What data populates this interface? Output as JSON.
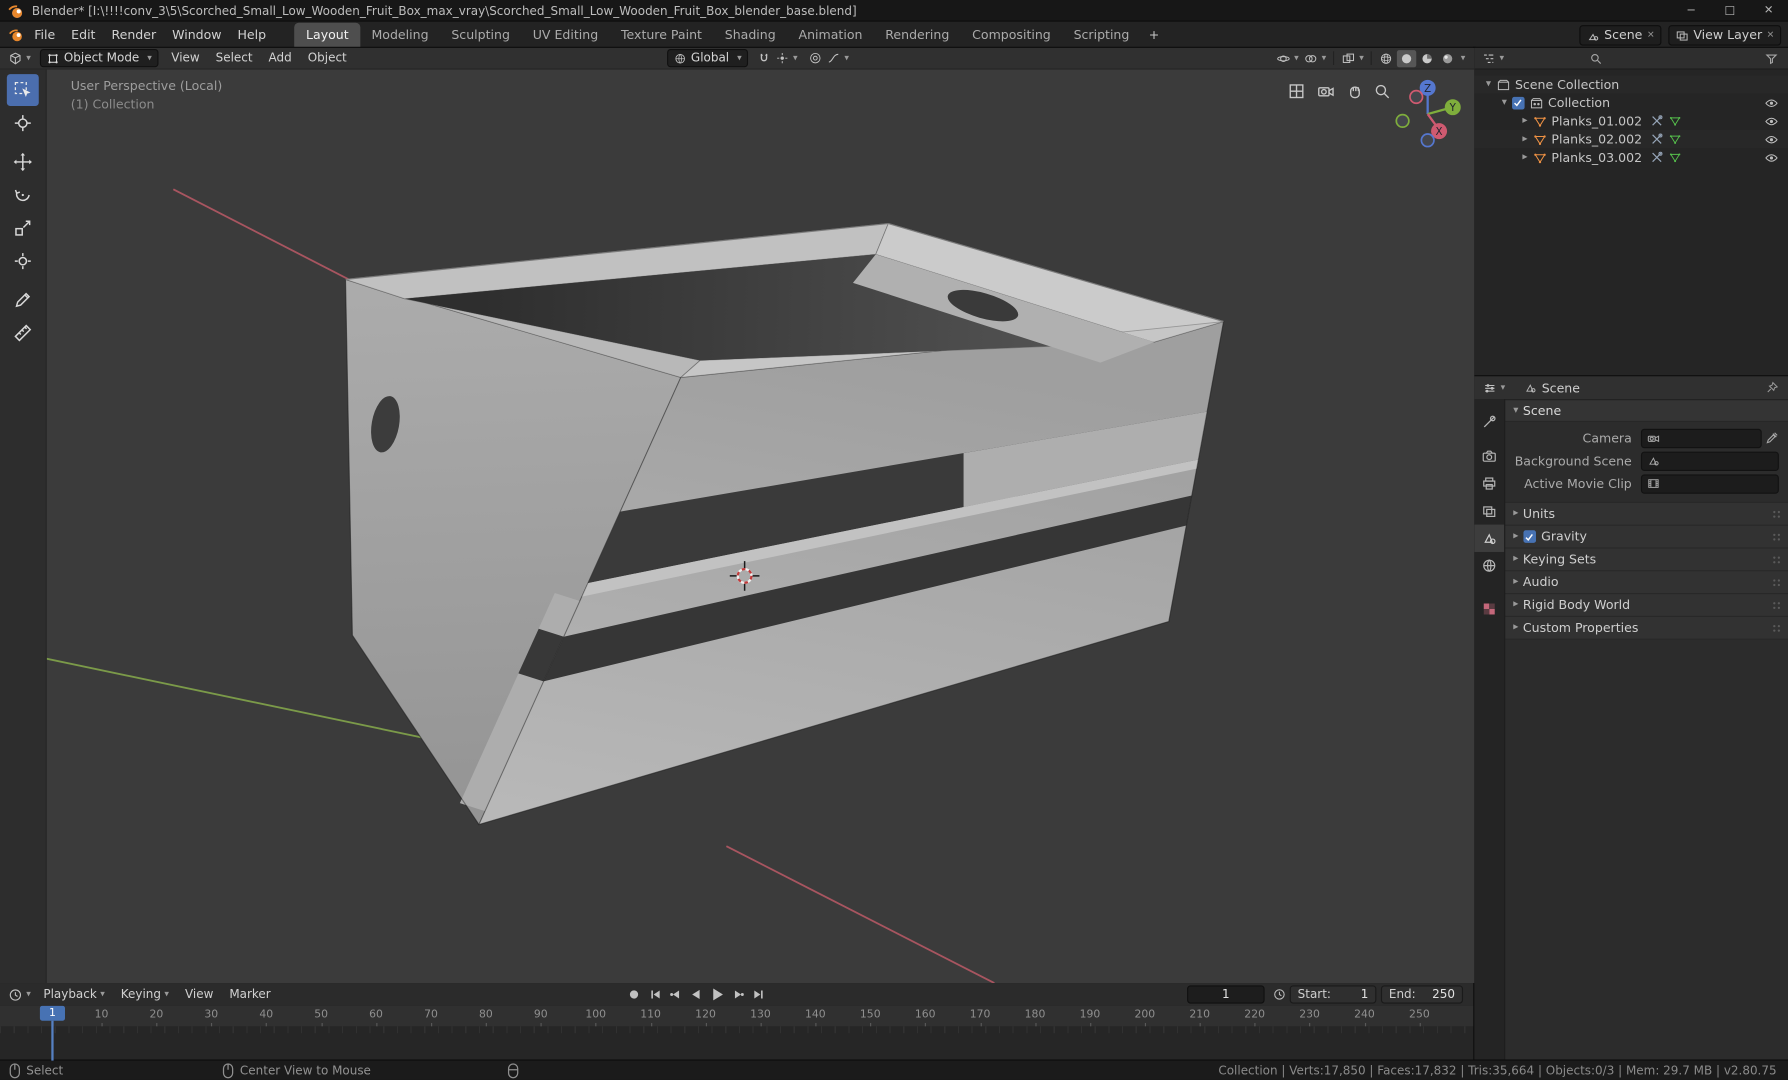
{
  "window": {
    "title": "Blender* [I:\\!!!!conv_3\\5\\Scorched_Small_Low_Wooden_Fruit_Box_max_vray\\Scorched_Small_Low_Wooden_Fruit_Box_blender_base.blend]",
    "controls": {
      "minimize": "−",
      "maximize": "□",
      "close": "✕"
    }
  },
  "topbar": {
    "menus": [
      {
        "label": "File"
      },
      {
        "label": "Edit"
      },
      {
        "label": "Render"
      },
      {
        "label": "Window"
      },
      {
        "label": "Help"
      }
    ],
    "tabs": [
      {
        "label": "Layout",
        "active": true
      },
      {
        "label": "Modeling"
      },
      {
        "label": "Sculpting"
      },
      {
        "label": "UV Editing"
      },
      {
        "label": "Texture Paint"
      },
      {
        "label": "Shading"
      },
      {
        "label": "Animation"
      },
      {
        "label": "Rendering"
      },
      {
        "label": "Compositing"
      },
      {
        "label": "Scripting"
      }
    ],
    "add_tab": "+",
    "scene": {
      "label": "Scene"
    },
    "view_layer": {
      "label": "View Layer"
    }
  },
  "viewport": {
    "header": {
      "mode": "Object Mode",
      "menus": [
        {
          "label": "View"
        },
        {
          "label": "Select"
        },
        {
          "label": "Add"
        },
        {
          "label": "Object"
        }
      ],
      "orientation": "Global"
    },
    "overlay": {
      "view_label": "User Perspective (Local)",
      "collection_label": "(1) Collection"
    },
    "gizmo": {
      "x": "X",
      "y": "Y",
      "z": "Z"
    }
  },
  "outliner": {
    "scene_collection": "Scene Collection",
    "collection": "Collection",
    "objects": [
      {
        "name": "Planks_01.002"
      },
      {
        "name": "Planks_02.002"
      },
      {
        "name": "Planks_03.002"
      }
    ]
  },
  "properties": {
    "breadcrumb": "Scene",
    "scene_section": "Scene",
    "fields": {
      "camera": "Camera",
      "background_scene": "Background Scene",
      "active_movie_clip": "Active Movie Clip"
    },
    "sections": [
      {
        "label": "Units"
      },
      {
        "label": "Gravity",
        "checkbox": true
      },
      {
        "label": "Keying Sets"
      },
      {
        "label": "Audio"
      },
      {
        "label": "Rigid Body World"
      },
      {
        "label": "Custom Properties"
      }
    ]
  },
  "timeline": {
    "menus": [
      {
        "label": "Playback",
        "caret": true
      },
      {
        "label": "Keying",
        "caret": true
      },
      {
        "label": "View"
      },
      {
        "label": "Marker"
      }
    ],
    "current_frame": "1",
    "playhead_frame": "1",
    "start_label": "Start:",
    "start_value": "1",
    "end_label": "End:",
    "end_value": "250",
    "ruler": [
      "10",
      "20",
      "30",
      "40",
      "50",
      "60",
      "70",
      "80",
      "90",
      "100",
      "110",
      "120",
      "130",
      "140",
      "150",
      "160",
      "170",
      "180",
      "190",
      "200",
      "210",
      "220",
      "230",
      "240",
      "250"
    ]
  },
  "statusbar": {
    "left": [
      {
        "label": "Select"
      },
      {
        "label": "Center View to Mouse"
      }
    ],
    "stats": "Collection | Verts:17,850 | Faces:17,832 | Tris:35,664 | Objects:0/3 | Mem: 29.7 MB | v2.80.75"
  },
  "icons": {
    "caret": "▾",
    "tri_right": "▸",
    "tri_down": "▾",
    "plus": "+",
    "x": "✕"
  }
}
